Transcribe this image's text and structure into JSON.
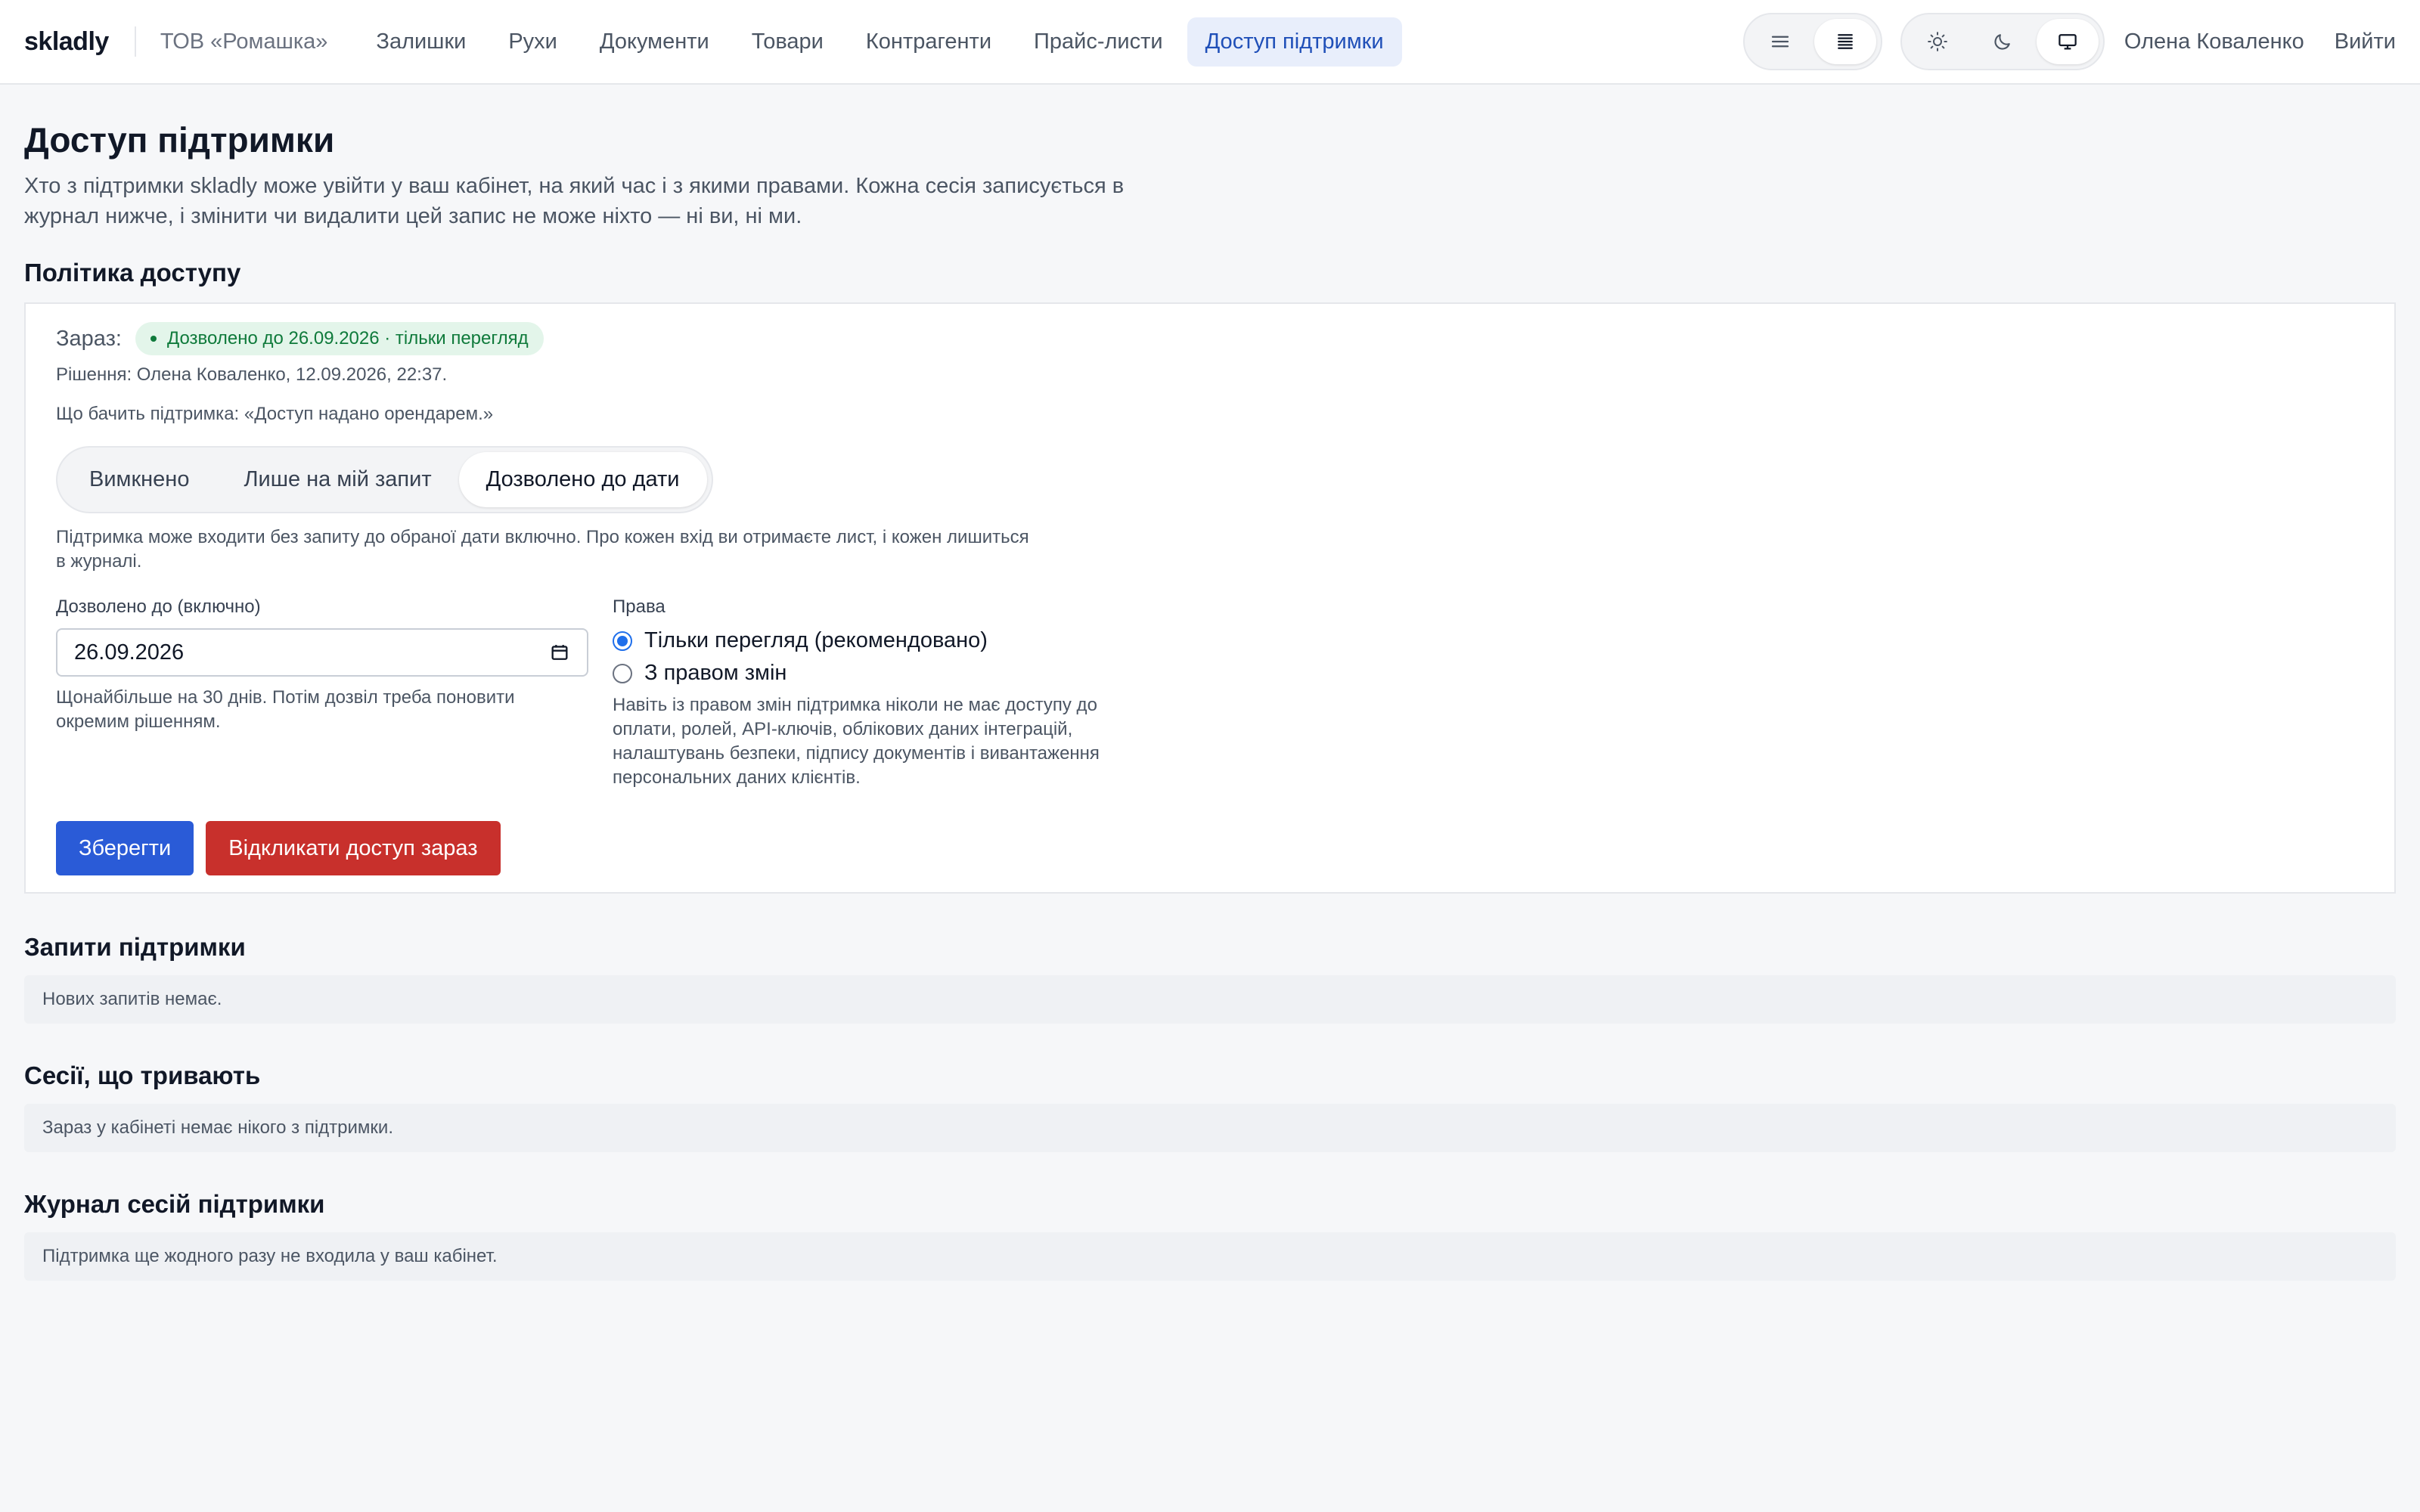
{
  "header": {
    "brand": "skladly",
    "org": "ТОВ «Ромашка»",
    "nav": [
      {
        "label": "Залишки"
      },
      {
        "label": "Рухи"
      },
      {
        "label": "Документи"
      },
      {
        "label": "Товари"
      },
      {
        "label": "Контрагенти"
      },
      {
        "label": "Прайс-листи"
      },
      {
        "label": "Доступ підтримки",
        "active": true
      }
    ],
    "density_toggle": {
      "options": [
        "list-compact-icon",
        "list-dense-icon"
      ],
      "selected": "list-dense-icon"
    },
    "theme_toggle": {
      "options": [
        "sun-icon",
        "moon-icon",
        "monitor-icon"
      ],
      "selected": "monitor-icon"
    },
    "user": "Олена Коваленко",
    "logout": "Вийти"
  },
  "page": {
    "title": "Доступ підтримки",
    "description": "Хто з підтримки skladly може увійти у ваш кабінет, на який час і з якими правами. Кожна сесія записується в журнал нижче, і змінити чи видалити цей запис не може ніхто — ні ви, ні ми."
  },
  "policy": {
    "title": "Політика доступу",
    "status_label": "Зараз:",
    "status_badge": "Дозволено до 26.09.2026 · тільки перегляд",
    "status_color": "#0f7a3b",
    "decision": "Рішення: Олена Коваленко, 12.09.2026, 22:37.",
    "support_sees": "Що бачить підтримка: «Доступ надано орендарем.»",
    "modes": [
      "Вимкнено",
      "Лише на мій запит",
      "Дозволено до дати"
    ],
    "selected_mode": "Дозволено до дати",
    "mode_hint": "Підтримка може входити без запиту до обраної дати включно. Про кожен вхід ви отримаєте лист, і кожен лишиться в журналі.",
    "date_label": "Дозволено до (включно)",
    "date_value": "26.09.2026",
    "date_hint": "Щонайбільше на 30 днів. Потім дозвіл треба поновити окремим рішенням.",
    "rights_label": "Права",
    "rights_options": [
      "Тільки перегляд (рекомендовано)",
      "З правом змін"
    ],
    "rights_selected": "Тільки перегляд (рекомендовано)",
    "rights_note": "Навіть із правом змін підтримка ніколи не має доступу до оплати, ролей, API-ключів, облікових даних інтеграцій, налаштувань безпеки, підпису документів і вивантаження персональних даних клієнтів.",
    "save_label": "Зберегти",
    "revoke_label": "Відкликати доступ зараз",
    "save_color": "#2a5bd7",
    "revoke_color": "#c8302c"
  },
  "requests": {
    "title": "Запити підтримки",
    "empty": "Нових запитів немає."
  },
  "sessions": {
    "title": "Сесії, що тривають",
    "empty": "Зараз у кабінеті немає нікого з підтримки."
  },
  "journal": {
    "title": "Журнал сесій підтримки",
    "empty": "Підтримка ще жодного разу не входила у ваш кабінет."
  }
}
